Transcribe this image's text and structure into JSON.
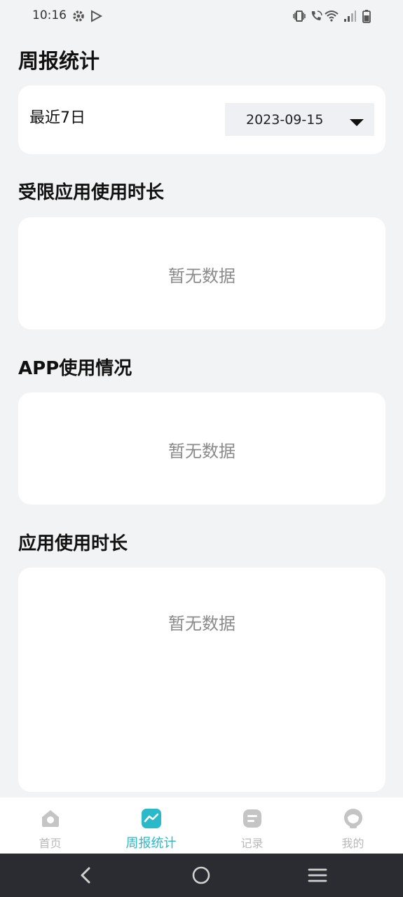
{
  "status_bar": {
    "time": "10:16",
    "icons": [
      "gear-icon",
      "play-store-icon",
      "vibrate-icon",
      "wifi-calling-icon",
      "wifi-icon",
      "signal-icon",
      "battery-icon"
    ]
  },
  "page": {
    "title": "周报统计"
  },
  "range_card": {
    "label": "最近7日",
    "date_value": "2023-09-15"
  },
  "sections": [
    {
      "title": "受限应用使用时长",
      "empty_text": "暂无数据"
    },
    {
      "title": "APP使用情况",
      "empty_text": "暂无数据"
    },
    {
      "title": "应用使用时长",
      "empty_text": "暂无数据"
    }
  ],
  "tabs": [
    {
      "label": "首页",
      "icon": "home-icon",
      "active": false
    },
    {
      "label": "周报统计",
      "icon": "trend-chart-icon",
      "active": true
    },
    {
      "label": "记录",
      "icon": "record-icon",
      "active": false
    },
    {
      "label": "我的",
      "icon": "profile-icon",
      "active": false
    }
  ],
  "colors": {
    "accent": "#29b9c9",
    "background": "#f2f3f5",
    "inactive_tab": "#b8b8b8",
    "nav_bar": "#2a2c31"
  },
  "system_nav": [
    "back-icon",
    "home-circle-icon",
    "recents-menu-icon"
  ]
}
